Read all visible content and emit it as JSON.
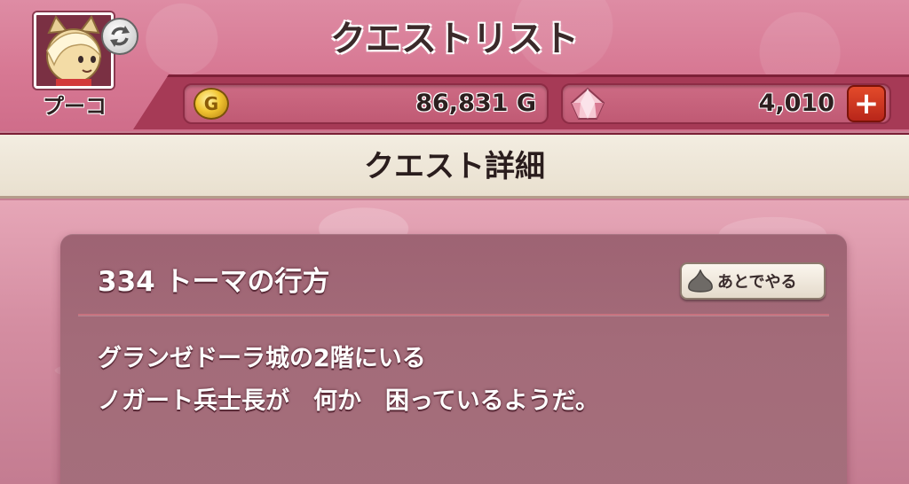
{
  "header": {
    "title": "クエストリスト",
    "player_name": "プーコ",
    "avatar_icon": "cat-character-avatar",
    "sync_icon": "refresh-icon"
  },
  "currency": {
    "gold_amount": "86,831 G",
    "gold_icon": "gold-coin-icon",
    "gem_amount": "4,010",
    "gem_icon": "pink-gem-icon",
    "add_icon": "+"
  },
  "section": {
    "title": "クエスト詳細"
  },
  "quest": {
    "title": "334 トーマの行方",
    "later_button_label": "あとでやる",
    "description_line1": "グランゼドーラ城の2階にいる",
    "description_line2": "ノガート兵士長が　何か　困っているようだ。"
  },
  "colors": {
    "header_pink": "#d77893",
    "currency_bar": "#a63a56",
    "panel": "#a36b79",
    "plus_button": "#d23a22"
  }
}
